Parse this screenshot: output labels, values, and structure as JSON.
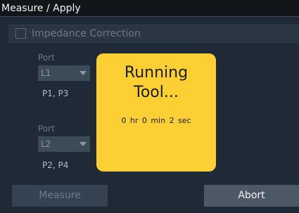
{
  "window": {
    "title": "Measure / Apply"
  },
  "impedance_correction": {
    "label": "Impedance Correction",
    "checked": false
  },
  "ports": [
    {
      "label": "Port",
      "selected": "L1",
      "pins": "P1, P3"
    },
    {
      "label": "Port",
      "selected": "L2",
      "pins": "P2, P4"
    }
  ],
  "overlay": {
    "title_line1": "Running",
    "title_line2": "Tool...",
    "elapsed": "0 hr  0 min  2 sec"
  },
  "buttons": {
    "measure": "Measure",
    "abort": "Abort"
  },
  "colors": {
    "overlay_bg": "#fcd034",
    "window_bg": "#1f2a36",
    "title_bar_bg": "#121519"
  },
  "icons": {
    "dropdown": "chevron-down-icon",
    "checkbox": "checkbox-icon"
  }
}
